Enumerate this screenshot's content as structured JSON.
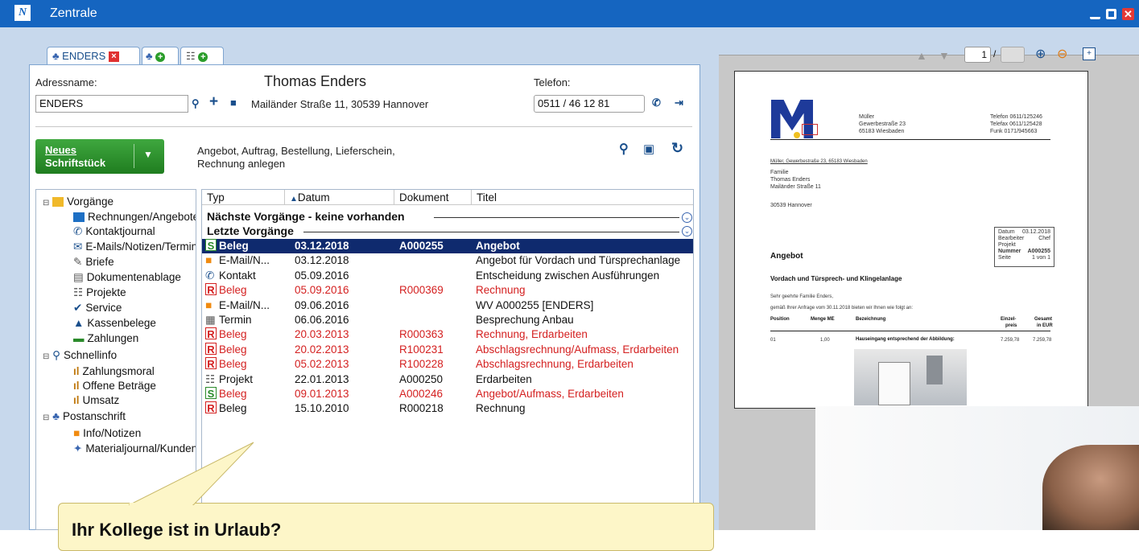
{
  "window": {
    "title": "Zentrale"
  },
  "tabs": {
    "active_label": "ENDERS"
  },
  "address": {
    "name_label": "Adressname:",
    "name_value": "ENDERS",
    "full_name": "Thomas Enders",
    "street": "Mailänder Straße 11, 30539 Hannover",
    "phone_label": "Telefon:",
    "phone_value": "0511 / 46 12 81"
  },
  "new_document": {
    "button_line1": "Neues",
    "button_line2": "Schriftstück",
    "hint_line1": "Angebot, Auftrag, Bestellung, Lieferschein,",
    "hint_line2": "Rechnung anlegen"
  },
  "tree": {
    "vorgaenge": "Vorgänge",
    "rechnungen": "Rechnungen/Angebote",
    "kontaktjournal": "Kontaktjournal",
    "emails": "E-Mails/Notizen/Termine",
    "briefe": "Briefe",
    "dokumentenablage": "Dokumentenablage",
    "projekte": "Projekte",
    "service": "Service",
    "kassenbelege": "Kassenbelege",
    "zahlungen": "Zahlungen",
    "schnellinfo": "Schnellinfo",
    "zahlungsmoral": "Zahlungsmoral",
    "offene": "Offene Beträge",
    "umsatz": "Umsatz",
    "postanschrift": "Postanschrift",
    "info": "Info/Notizen",
    "material": "Materialjournal/Kunden"
  },
  "grid": {
    "col_typ": "Typ",
    "col_datum": "Datum",
    "col_dokument": "Dokument",
    "col_titel": "Titel",
    "group_next": "Nächste Vorgänge - keine vorhanden",
    "group_last": "Letzte Vorgänge",
    "rows": [
      {
        "badge": "S",
        "typ": "Beleg",
        "datum": "03.12.2018",
        "dok": "A000255",
        "titel": "Angebot",
        "state": "selected"
      },
      {
        "badge": "",
        "typ": "E-Mail/N...",
        "datum": "03.12.2018",
        "dok": "",
        "titel": "Angebot für Vordach und Türsprechanlage",
        "state": "normal"
      },
      {
        "badge": "",
        "typ": "Kontakt",
        "datum": "05.09.2016",
        "dok": "",
        "titel": "Entscheidung zwischen Ausführungen",
        "state": "normal"
      },
      {
        "badge": "R",
        "typ": "Beleg",
        "datum": "05.09.2016",
        "dok": "R000369",
        "titel": "Rechnung",
        "state": "red"
      },
      {
        "badge": "",
        "typ": "E-Mail/N...",
        "datum": "09.06.2016",
        "dok": "",
        "titel": "WV A000255 [ENDERS]",
        "state": "normal"
      },
      {
        "badge": "",
        "typ": "Termin",
        "datum": "06.06.2016",
        "dok": "",
        "titel": "Besprechung Anbau",
        "state": "normal"
      },
      {
        "badge": "R",
        "typ": "Beleg",
        "datum": "20.03.2013",
        "dok": "R000363",
        "titel": "Rechnung, Erdarbeiten",
        "state": "red"
      },
      {
        "badge": "R",
        "typ": "Beleg",
        "datum": "20.02.2013",
        "dok": "R100231",
        "titel": "Abschlagsrechnung/Aufmass, Erdarbeiten",
        "state": "red"
      },
      {
        "badge": "R",
        "typ": "Beleg",
        "datum": "05.02.2013",
        "dok": "R100228",
        "titel": "Abschlagsrechnung, Erdarbeiten",
        "state": "red"
      },
      {
        "badge": "",
        "typ": "Projekt",
        "datum": "22.01.2013",
        "dok": "A000250",
        "titel": "Erdarbeiten",
        "state": "normal"
      },
      {
        "badge": "S",
        "typ": "Beleg",
        "datum": "09.01.2013",
        "dok": "A000246",
        "titel": "Angebot/Aufmass, Erdarbeiten",
        "state": "red"
      },
      {
        "badge": "R",
        "typ": "Beleg",
        "datum": "15.10.2010",
        "dok": "R000218",
        "titel": "Rechnung",
        "state": "normal"
      }
    ]
  },
  "preview": {
    "page_current": "1",
    "page_sep": "/",
    "company_name": "Müller",
    "company_street": "Gewerbestraße 23",
    "company_city": "65183 Wiesbaden",
    "tel": "Telefon   0611/125246",
    "fax": "Telefax   0611/125428",
    "funk": "Funk       0171/945663",
    "sender_line": "Müller, Gewerbestraße 23, 65183 Wiesbaden",
    "rcpt1": "Familie",
    "rcpt2": "Thomas Enders",
    "rcpt3": "Mailänder Straße 11",
    "rcpt4": "30539 Hannover",
    "meta_datum_l": "Datum",
    "meta_datum_v": "03.12.2018",
    "meta_bearb_l": "Bearbeiter",
    "meta_bearb_v": "Chef",
    "meta_proj_l": "Projekt",
    "meta_nr_l": "Nummer",
    "meta_nr_v": "A000255",
    "meta_seite_l": "Seite",
    "meta_seite_v": "1 von 1",
    "doc_title": "Angebot",
    "subject": "Vordach und Türsprech- und Klingelanlage",
    "greeting": "Sehr geehrte Familie Enders,",
    "intro": "gemäß Ihrer Anfrage vom 30.11.2018 bieten wir Ihnen wie folgt an:",
    "th_pos": "Position",
    "th_menge": "Menge ME",
    "th_bez": "Bezeichnung",
    "th_einzel1": "Einzel-",
    "th_einzel2": "preis",
    "th_gesamt1": "Gesamt",
    "th_gesamt2": "in EUR",
    "item_pos": "01",
    "item_menge": "1,00",
    "item_bez": "Hauseingang entsprechend der Abbildung:",
    "item_einzel": "7.259,78",
    "item_gesamt": "7.259,78"
  },
  "bubble": {
    "text": "Ihr Kollege ist in Urlaub?"
  },
  "colors": {
    "titlebar": "#1565c0",
    "accent_green": "#2a9d2a",
    "selection": "#0f2a6e",
    "red_text": "#d42020"
  }
}
